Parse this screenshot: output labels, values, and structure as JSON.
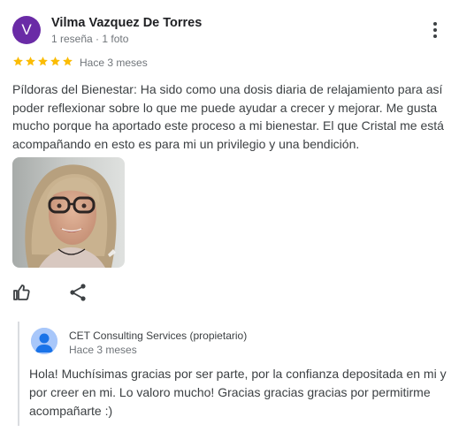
{
  "reviewer": {
    "initial": "V",
    "name": "Vilma Vazquez De Torres",
    "meta": "1 reseña · 1 foto",
    "avatar_color": "#6a2ba6"
  },
  "review": {
    "rating": 5,
    "max_rating": 5,
    "star_color": "#fbbc04",
    "date": "Hace 3 meses",
    "text": "Píldoras del Bienestar: Ha sido como una dosis diaria de relajamiento para así poder reflexionar sobre lo que me puede ayudar a crecer y mejorar. Me gusta mucho porque ha aportado este proceso a mi bienestar. El que Cristal me está acompañando en esto es para mi un privilegio y una bendición."
  },
  "actions": {
    "more_icon": "more-vert-icon",
    "like_icon": "thumb-up-icon",
    "share_icon": "share-icon"
  },
  "owner_response": {
    "name": "CET Consulting Services (propietario)",
    "date": "Hace 3 meses",
    "text": "Hola! Muchísimas gracias por ser parte, por la confianza depositada en mi y por creer en mi. Lo valoro mucho! Gracias gracias gracias por permitirme acompañarte :)"
  }
}
